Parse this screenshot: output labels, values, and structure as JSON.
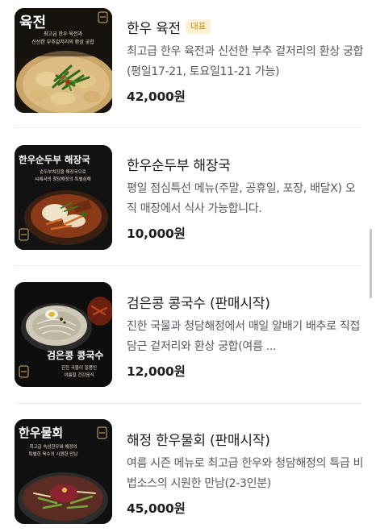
{
  "menu": {
    "items": [
      {
        "name": "한우 육전",
        "badge": "대표",
        "description": "최고급 한우 육전과 신선한 부추 겉저리의 환상 궁합(평일17-21, 토요일11-21 가능)",
        "price": "42,000원",
        "image": {
          "overlay_title": "육전",
          "overlay_line1": "최고급 한우 육전과",
          "overlay_line2": "신선한 부추겉저리의 환상 궁합"
        }
      },
      {
        "name": "한우순두부 해장국",
        "badge": "",
        "description": "평일 점심특선 메뉴(주말, 공휴일, 포장, 배달X) 오직 매장에서 식사 가능합니다.",
        "price": "10,000원",
        "image": {
          "overlay_title": "한우순두부 해장국",
          "overlay_line1": "순두부치킹을 해장국으로",
          "overlay_line2": "씨에서의 청담해정의 특별심해"
        }
      },
      {
        "name": "검은콩 콩국수 (판매시작)",
        "badge": "",
        "description": "진한 국물과 청담해정에서 매일 알배기 배추로 직접 담근 겉저리와 환상 궁합(여름 ...",
        "price": "12,000원",
        "image": {
          "overlay_title": "검은콩 콩국수",
          "overlay_line1": "진한 국물이 일품인",
          "overlay_line2": "여름철 건강음식"
        }
      },
      {
        "name": "해정 한우물회 (판매시작)",
        "badge": "",
        "description": "여름 시즌 메뉴로 최고급 한우와 청담해정의 특급 비법소스의 시원한 만남(2-3인분)",
        "price": "45,000원",
        "image": {
          "overlay_title": "한우물회",
          "overlay_line1": "최고급 숙성한우와 해정의",
          "overlay_line2": "특별한 육수의 시원한 만남"
        }
      }
    ]
  },
  "colors": {
    "badge_bg": "#fdf1d6",
    "badge_text": "#c98a17",
    "price_text": "#1e1e1e",
    "desc_text": "#555a60"
  }
}
